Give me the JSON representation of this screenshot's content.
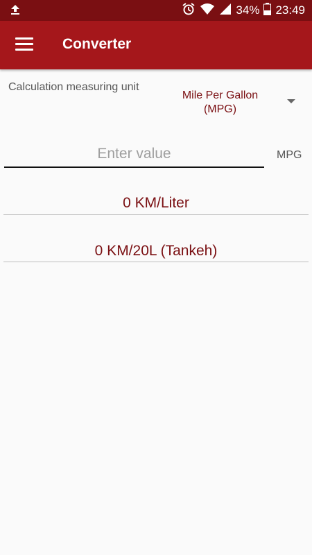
{
  "status_bar": {
    "upload_icon": "upload-icon",
    "alarm_icon": "alarm-icon",
    "wifi_icon": "wifi-icon",
    "signal_icon": "signal-icon",
    "battery_text": "34%",
    "battery_icon": "battery-icon",
    "time": "23:49"
  },
  "app_bar": {
    "menu_icon": "hamburger-menu-icon",
    "title": "Converter"
  },
  "form": {
    "unit_label": "Calculation measuring unit",
    "selected_unit_line1": "Mile Per Gallon",
    "selected_unit_line2": "(MPG)",
    "input_placeholder": "Enter value",
    "input_value": "",
    "unit_suffix": "MPG"
  },
  "results": {
    "km_per_liter": "0 KM/Liter",
    "km_per_20l": "0 KM/20L (Tankeh)"
  },
  "colors": {
    "status_bar": "#7a0f12",
    "app_bar": "#a5171b",
    "accent_text": "#7a0f12",
    "background": "#fafafa"
  }
}
